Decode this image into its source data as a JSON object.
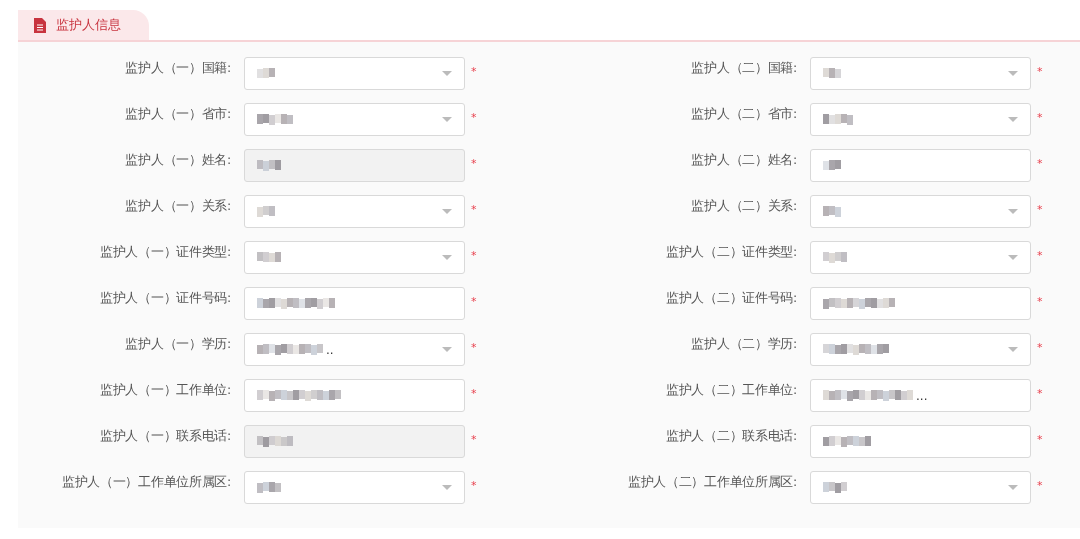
{
  "section_tab": {
    "title": "监护人信息",
    "selected": true
  },
  "columns": [
    {
      "fields": [
        {
          "label": "监护人（一）国籍:",
          "kind": "select",
          "disabled": false,
          "required_mark": "*"
        },
        {
          "label": "监护人（一）省市:",
          "kind": "select",
          "disabled": false,
          "required_mark": "*"
        },
        {
          "label": "监护人（一）姓名:",
          "kind": "text",
          "disabled": true,
          "required_mark": "*"
        },
        {
          "label": "监护人（一）关系:",
          "kind": "select",
          "disabled": false,
          "required_mark": "*"
        },
        {
          "label": "监护人（一）证件类型:",
          "kind": "select",
          "disabled": false,
          "required_mark": "*"
        },
        {
          "label": "监护人（一）证件号码:",
          "kind": "text",
          "disabled": false,
          "required_mark": "*"
        },
        {
          "label": "监护人（一）学历:",
          "kind": "select",
          "disabled": false,
          "required_mark": "*",
          "ellipsis": ".."
        },
        {
          "label": "监护人（一）工作单位:",
          "kind": "text",
          "disabled": false,
          "required_mark": "*"
        },
        {
          "label": "监护人（一）联系电话:",
          "kind": "text",
          "disabled": true,
          "required_mark": "*"
        },
        {
          "label": "监护人（一）工作单位所属区:",
          "kind": "select",
          "disabled": false,
          "required_mark": "*"
        }
      ]
    },
    {
      "fields": [
        {
          "label": "监护人（二）国籍:",
          "kind": "select",
          "disabled": false,
          "required_mark": "*"
        },
        {
          "label": "监护人（二）省市:",
          "kind": "select",
          "disabled": false,
          "required_mark": "*"
        },
        {
          "label": "监护人（二）姓名:",
          "kind": "text",
          "disabled": false,
          "required_mark": "*"
        },
        {
          "label": "监护人（二）关系:",
          "kind": "select",
          "disabled": false,
          "required_mark": "*"
        },
        {
          "label": "监护人（二）证件类型:",
          "kind": "select",
          "disabled": false,
          "required_mark": "*"
        },
        {
          "label": "监护人（二）证件号码:",
          "kind": "text",
          "disabled": false,
          "required_mark": "*"
        },
        {
          "label": "监护人（二）学历:",
          "kind": "select",
          "disabled": false,
          "required_mark": "*"
        },
        {
          "label": "监护人（二）工作单位:",
          "kind": "text",
          "disabled": false,
          "required_mark": "*",
          "ellipsis": "..."
        },
        {
          "label": "监护人（二）联系电话:",
          "kind": "text",
          "disabled": false,
          "required_mark": "*"
        },
        {
          "label": "监护人（二）工作单位所属区:",
          "kind": "select",
          "disabled": false,
          "required_mark": "*"
        }
      ]
    }
  ]
}
